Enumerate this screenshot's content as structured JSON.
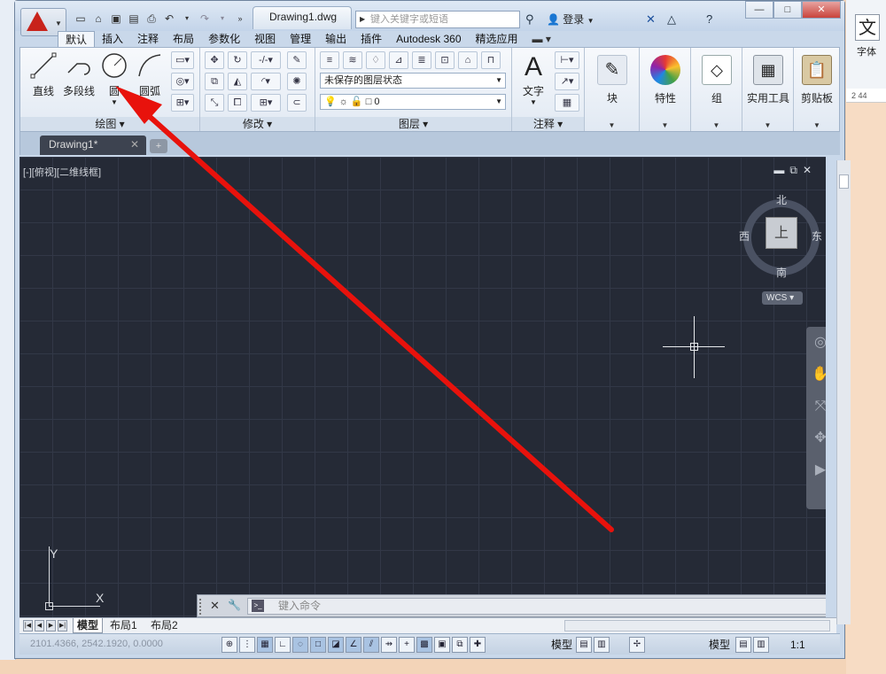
{
  "app": {
    "document_tab": "Drawing1.dwg",
    "search_placeholder": "键入关键字或短语",
    "login": "登录"
  },
  "ribbon_tabs": [
    "默认",
    "插入",
    "注释",
    "布局",
    "参数化",
    "视图",
    "管理",
    "输出",
    "插件",
    "Autodesk 360",
    "精选应用"
  ],
  "ribbon": {
    "draw": {
      "title": "绘图",
      "line": "直线",
      "polyline": "多段线",
      "circle": "圆",
      "arc": "圆弧"
    },
    "modify": {
      "title": "修改"
    },
    "layers": {
      "title": "图层",
      "layer_state": "未保存的图层状态",
      "current_layer": "0"
    },
    "annotation": {
      "title": "注释",
      "text": "文字"
    },
    "block": "块",
    "properties": "特性",
    "group": "组",
    "utilities": "实用工具",
    "clipboard": "剪贴板"
  },
  "file_tab": "Drawing1*",
  "canvas": {
    "viewport_label": "[-][俯视][二维线框]",
    "viewcube": {
      "top": "上",
      "north": "北",
      "south": "南",
      "east": "东",
      "west": "西"
    },
    "wcs": "WCS",
    "ucs_x": "X",
    "ucs_y": "Y",
    "command_placeholder": "键入命令"
  },
  "layout_tabs": [
    "模型",
    "布局1",
    "布局2"
  ],
  "status": {
    "coordinates": "2101.4366, 2542.1920, 0.0000",
    "model": "模型",
    "model2": "模型",
    "scale": "1:1"
  },
  "background_app": {
    "font_char": "文",
    "font_label": "字体",
    "ruler_text": "2    44"
  },
  "colors": {
    "canvas_bg": "#252a36",
    "autocad_red": "#c8231b",
    "arrow_red": "#e8120c"
  }
}
